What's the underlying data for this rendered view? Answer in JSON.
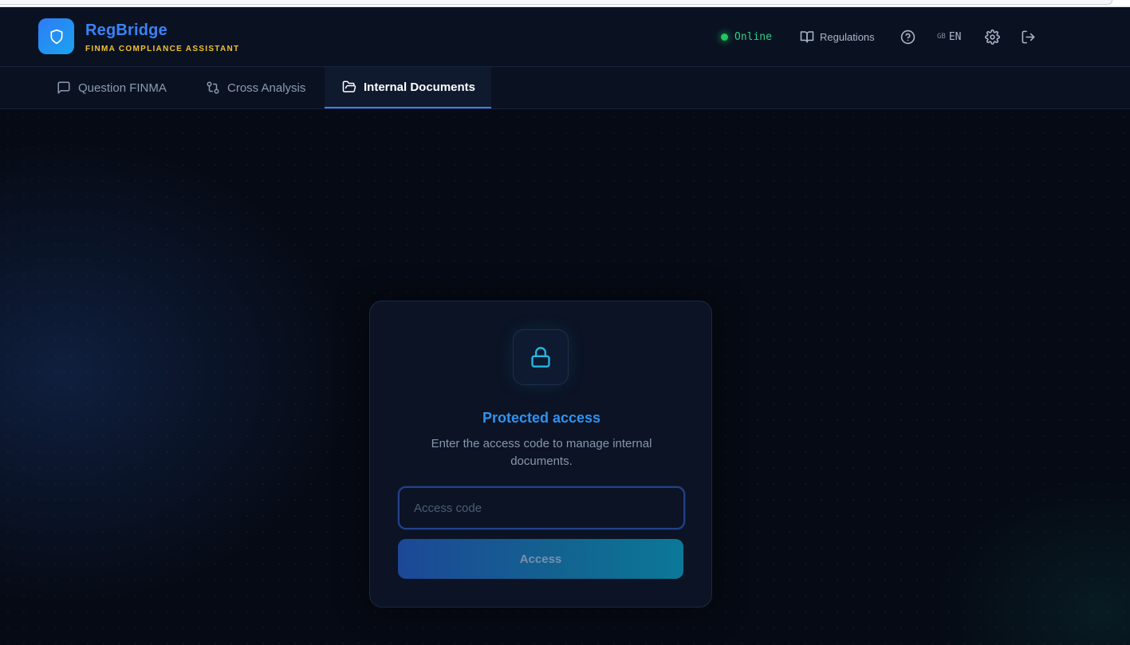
{
  "header": {
    "brand_name": "RegBridge",
    "brand_subtitle": "FINMA COMPLIANCE ASSISTANT",
    "status_label": "Online",
    "regulations_label": "Regulations",
    "language_country": "GB",
    "language_code": "EN"
  },
  "nav": {
    "tabs": [
      {
        "label": "Question FINMA",
        "icon": "message-square-icon",
        "active": false
      },
      {
        "label": "Cross Analysis",
        "icon": "git-compare-icon",
        "active": false
      },
      {
        "label": "Internal Documents",
        "icon": "folder-open-icon",
        "active": true
      }
    ]
  },
  "access_card": {
    "title": "Protected access",
    "description": "Enter the access code to manage internal documents.",
    "input_placeholder": "Access code",
    "input_value": "",
    "button_label": "Access"
  },
  "colors": {
    "accent": "#3b82f6",
    "brand_subtitle": "#f2c230",
    "status_online": "#22c55e",
    "lock_icon": "#22b8e6"
  }
}
